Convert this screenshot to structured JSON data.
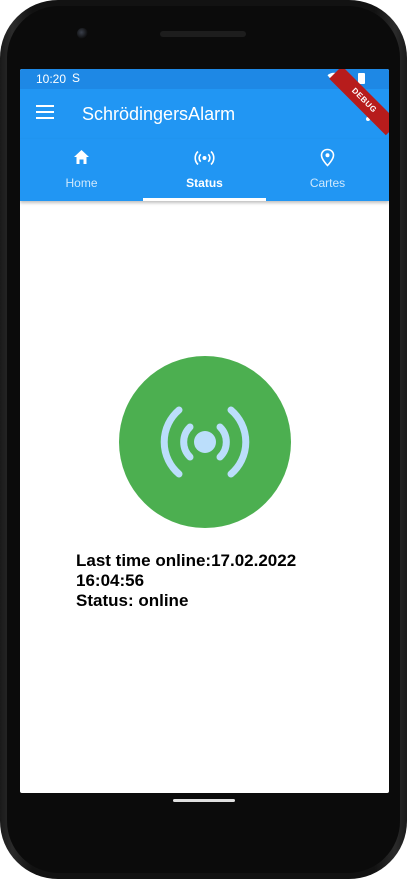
{
  "statusbar": {
    "time": "10:20",
    "sim_icon": "sim-card-icon",
    "wifi_icon": "wifi-icon",
    "battery_icon": "battery-icon"
  },
  "debug_banner": "DEBUG",
  "appbar": {
    "title": "SchrödingersAlarm",
    "menu_icon": "hamburger-menu-icon",
    "more_icon": "more-vertical-icon"
  },
  "tabs": [
    {
      "label": "Home",
      "icon": "home-icon",
      "active": false
    },
    {
      "label": "Status",
      "icon": "broadcast-icon",
      "active": true
    },
    {
      "label": "Cartes",
      "icon": "map-pin-icon",
      "active": false
    }
  ],
  "status": {
    "indicator_icon": "broadcast-signal-icon",
    "indicator_color": "#4caf50",
    "last_online_line1": "Last time online:17.02.2022",
    "last_online_line2": "16:04:56",
    "status_line": "Status: online"
  },
  "colors": {
    "appbar": "#2196f3",
    "statusbar": "#1e88e5",
    "online": "#4caf50",
    "signal": "#bbdefb"
  }
}
